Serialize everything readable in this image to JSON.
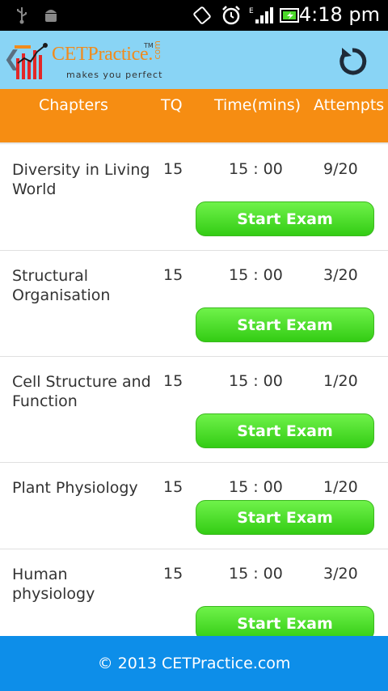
{
  "status_bar": {
    "time": "4:18 pm",
    "icons": [
      "usb-icon",
      "android-icon",
      "rotation-icon",
      "alarm-icon",
      "signal-icon",
      "battery-icon"
    ]
  },
  "app_bar": {
    "back_glyph": "❮",
    "logo_word": "CETPractice.",
    "logo_tm": "TM",
    "logo_com": "com",
    "logo_tagline": "makes you perfect",
    "refresh_icon": "refresh-icon"
  },
  "columns": {
    "chapters": "Chapters",
    "tq": "TQ",
    "time": "Time(mins)",
    "attempts": "Attempts"
  },
  "rows": [
    {
      "chapter": "Diversity in Living World",
      "tq": "15",
      "time": "15 : 00",
      "attempts": "9/20",
      "button": "Start Exam"
    },
    {
      "chapter": "Structural Organisation",
      "tq": "15",
      "time": "15 : 00",
      "attempts": "3/20",
      "button": "Start Exam"
    },
    {
      "chapter": "Cell Structure and Function",
      "tq": "15",
      "time": "15 : 00",
      "attempts": "1/20",
      "button": "Start Exam"
    },
    {
      "chapter": "Plant Physiology",
      "tq": "15",
      "time": "15 : 00",
      "attempts": "1/20",
      "button": "Start Exam"
    },
    {
      "chapter": "Human physiology",
      "tq": "15",
      "time": "15 : 00",
      "attempts": "3/20",
      "button": "Start Exam"
    }
  ],
  "footer": {
    "text": "© 2013 CETPractice.com"
  },
  "colors": {
    "header_orange": "#f68d12",
    "app_bar_blue": "#89d4f5",
    "footer_blue": "#0d8ee9",
    "button_green": "#4cd92a"
  }
}
